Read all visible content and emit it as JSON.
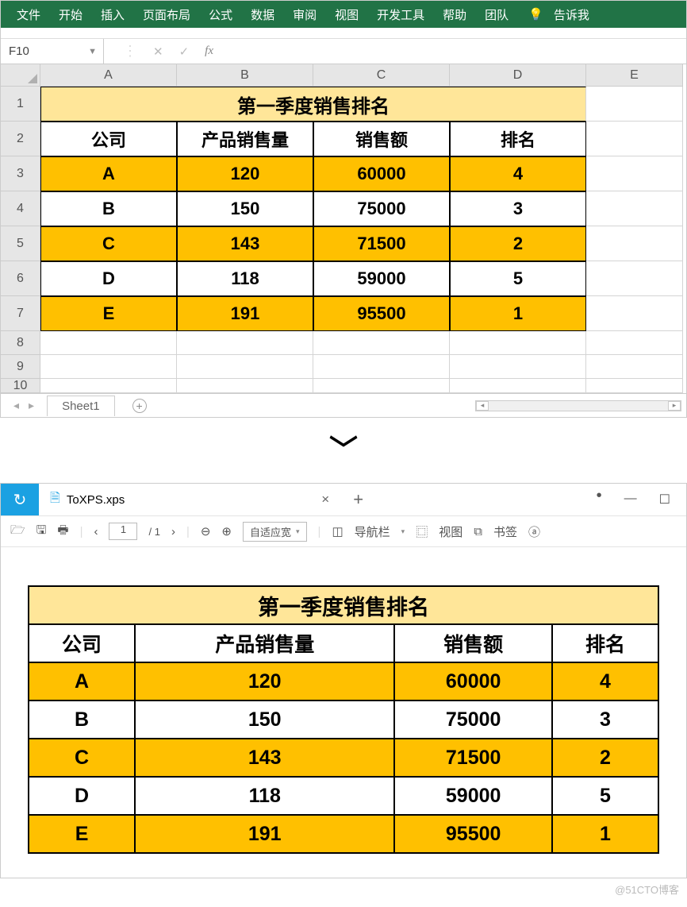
{
  "ribbon": {
    "tabs": [
      "文件",
      "开始",
      "插入",
      "页面布局",
      "公式",
      "数据",
      "审阅",
      "视图",
      "开发工具",
      "帮助",
      "团队"
    ],
    "tell_me": "告诉我"
  },
  "namebox": "F10",
  "columns": [
    "A",
    "B",
    "C",
    "D",
    "E"
  ],
  "rows": [
    "1",
    "2",
    "3",
    "4",
    "5",
    "6",
    "7",
    "8",
    "9",
    "10"
  ],
  "table": {
    "title": "第一季度销售排名",
    "headers": [
      "公司",
      "产品销售量",
      "销售额",
      "排名"
    ],
    "data": [
      {
        "company": "A",
        "qty": "120",
        "sales": "60000",
        "rank": "4",
        "shade": "yellow"
      },
      {
        "company": "B",
        "qty": "150",
        "sales": "75000",
        "rank": "3",
        "shade": "white"
      },
      {
        "company": "C",
        "qty": "143",
        "sales": "71500",
        "rank": "2",
        "shade": "yellow"
      },
      {
        "company": "D",
        "qty": "118",
        "sales": "59000",
        "rank": "5",
        "shade": "white"
      },
      {
        "company": "E",
        "qty": "191",
        "sales": "95500",
        "rank": "1",
        "shade": "yellow"
      }
    ]
  },
  "sheet_tab": "Sheet1",
  "xps": {
    "filename": "ToXPS.xps",
    "page_current": "1",
    "page_total": "/ 1",
    "fit_label": "自适应宽",
    "nav_label": "导航栏",
    "view_label": "视图",
    "bookmark_label": "书签"
  },
  "watermark": "@51CTO博客"
}
